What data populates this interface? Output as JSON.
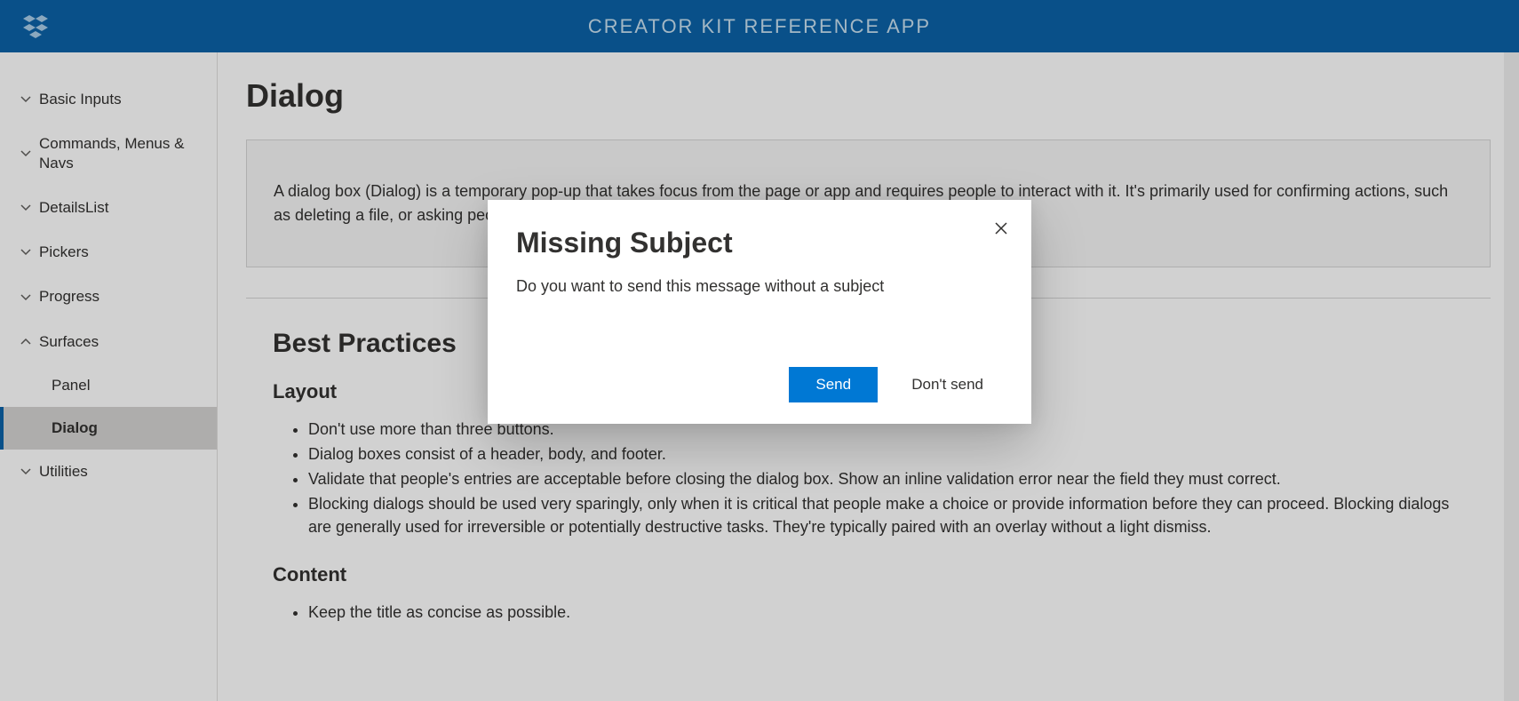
{
  "header": {
    "title": "CREATOR KIT REFERENCE APP"
  },
  "sidebar": {
    "items": [
      {
        "label": "Basic Inputs",
        "expanded": false
      },
      {
        "label": "Commands, Menus & Navs",
        "expanded": false
      },
      {
        "label": "DetailsList",
        "expanded": false
      },
      {
        "label": "Pickers",
        "expanded": false
      },
      {
        "label": "Progress",
        "expanded": false
      },
      {
        "label": "Surfaces",
        "expanded": true,
        "children": [
          {
            "label": "Panel",
            "selected": false
          },
          {
            "label": "Dialog",
            "selected": true
          }
        ]
      },
      {
        "label": "Utilities",
        "expanded": false
      }
    ]
  },
  "page": {
    "title": "Dialog",
    "description": "A dialog box (Dialog) is a temporary pop-up that takes focus from the page or app and requires people to interact with it. It's primarily used for confirming actions, such as deleting a file, or asking people to make a choice.",
    "best_practices_heading": "Best Practices",
    "layout_heading": "Layout",
    "layout_items": [
      "Don't use more than three buttons.",
      "Dialog boxes consist of a header, body, and footer.",
      "Validate that people's entries are acceptable before closing the dialog box. Show an inline validation error near the field they must correct.",
      "Blocking dialogs should be used very sparingly, only when it is critical that people make a choice or provide information before they can proceed. Blocking dialogs are generally used for irreversible or potentially destructive tasks. They're typically paired with an overlay without a light dismiss."
    ],
    "content_heading": "Content",
    "content_items": [
      "Keep the title as concise as possible."
    ]
  },
  "dialog": {
    "title": "Missing Subject",
    "body": "Do you want to send this message without a subject",
    "primary_label": "Send",
    "secondary_label": "Don't send"
  }
}
